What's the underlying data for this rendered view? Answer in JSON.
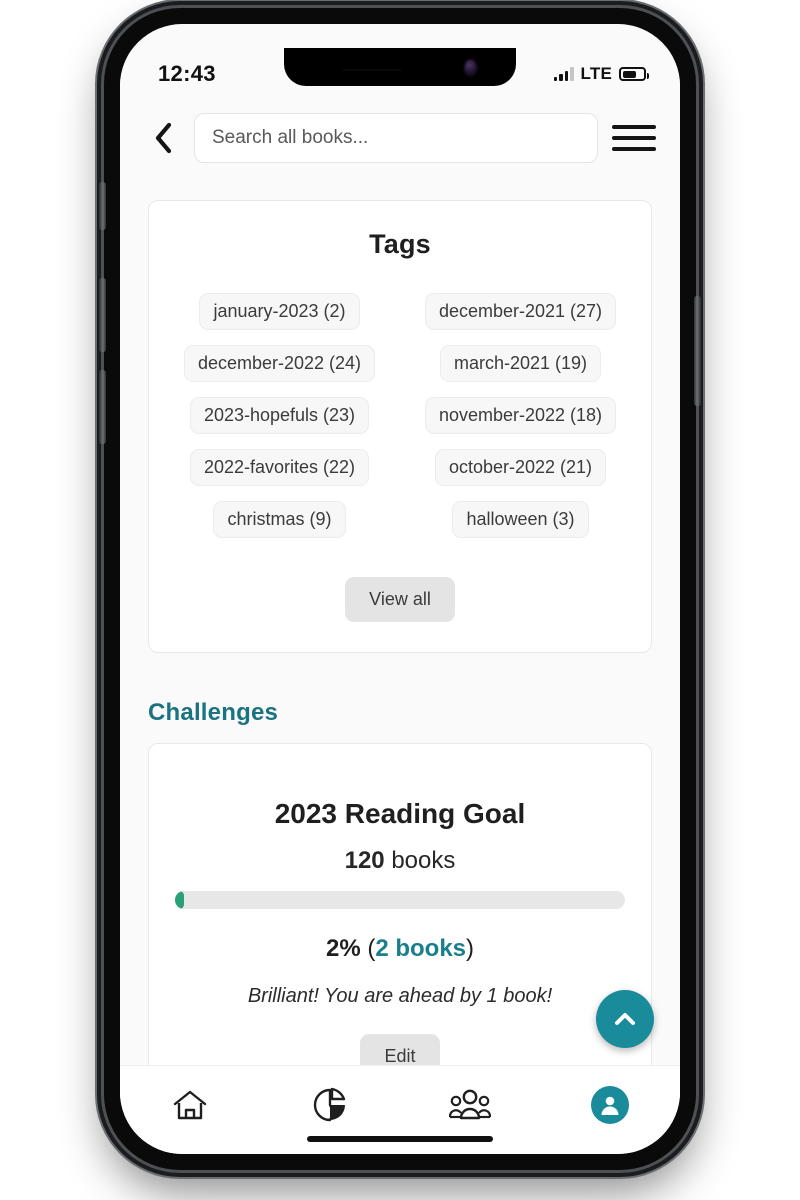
{
  "theme": {
    "teal": "#1A8B9B",
    "teal_dark": "#1A7380",
    "green": "#28A177",
    "page_bg": "#FAFAFA",
    "card_bg": "#FFFFFF",
    "chip_bg": "#F7F7F7",
    "grey_button_bg": "#E4E4E4",
    "text": "#1F1F1F"
  },
  "status_bar": {
    "time": "12:43",
    "network_label": "LTE",
    "signal_icon": "signal-bars-icon",
    "signal_bars_filled": 3,
    "signal_bars_total": 4,
    "battery_icon": "battery-icon",
    "battery_percent": 58
  },
  "header": {
    "back_icon": "chevron-left-icon",
    "search": {
      "placeholder": "Search all books...",
      "value": "",
      "icon": "search-input"
    },
    "menu_icon": "hamburger-menu-icon"
  },
  "tags_card": {
    "title": "Tags",
    "chips": [
      {
        "label": "january-2023 (2)",
        "name": "january-2023",
        "count": 2
      },
      {
        "label": "december-2021 (27)",
        "name": "december-2021",
        "count": 27
      },
      {
        "label": "december-2022 (24)",
        "name": "december-2022",
        "count": 24
      },
      {
        "label": "march-2021 (19)",
        "name": "march-2021",
        "count": 19
      },
      {
        "label": "2023-hopefuls (23)",
        "name": "2023-hopefuls",
        "count": 23
      },
      {
        "label": "november-2022 (18)",
        "name": "november-2022",
        "count": 18
      },
      {
        "label": "2022-favorites (22)",
        "name": "2022-favorites",
        "count": 22
      },
      {
        "label": "october-2022 (21)",
        "name": "october-2022",
        "count": 21
      },
      {
        "label": "christmas (9)",
        "name": "christmas",
        "count": 9
      },
      {
        "label": "halloween (3)",
        "name": "halloween",
        "count": 3
      }
    ],
    "view_all_label": "View all"
  },
  "challenges": {
    "section_label": "Challenges",
    "goal_card": {
      "title": "2023 Reading Goal",
      "target_number": "120",
      "target_unit": "books",
      "percent_label": "2%",
      "progress_percent": 2,
      "progress_detail_open": "(",
      "progress_detail": "2 books",
      "progress_detail_close": ")",
      "message": "Brilliant! You are ahead by 1 book!",
      "edit_label": "Edit"
    }
  },
  "fab": {
    "icon": "chevron-up-icon",
    "name": "scroll-to-top-button"
  },
  "bottom_nav": {
    "items": [
      {
        "icon": "home-icon",
        "name": "nav-home",
        "active": false
      },
      {
        "icon": "pie-chart-icon",
        "name": "nav-stats",
        "active": false
      },
      {
        "icon": "people-group-icon",
        "name": "nav-community",
        "active": false
      },
      {
        "icon": "user-profile-icon",
        "name": "nav-profile",
        "active": true
      }
    ]
  }
}
